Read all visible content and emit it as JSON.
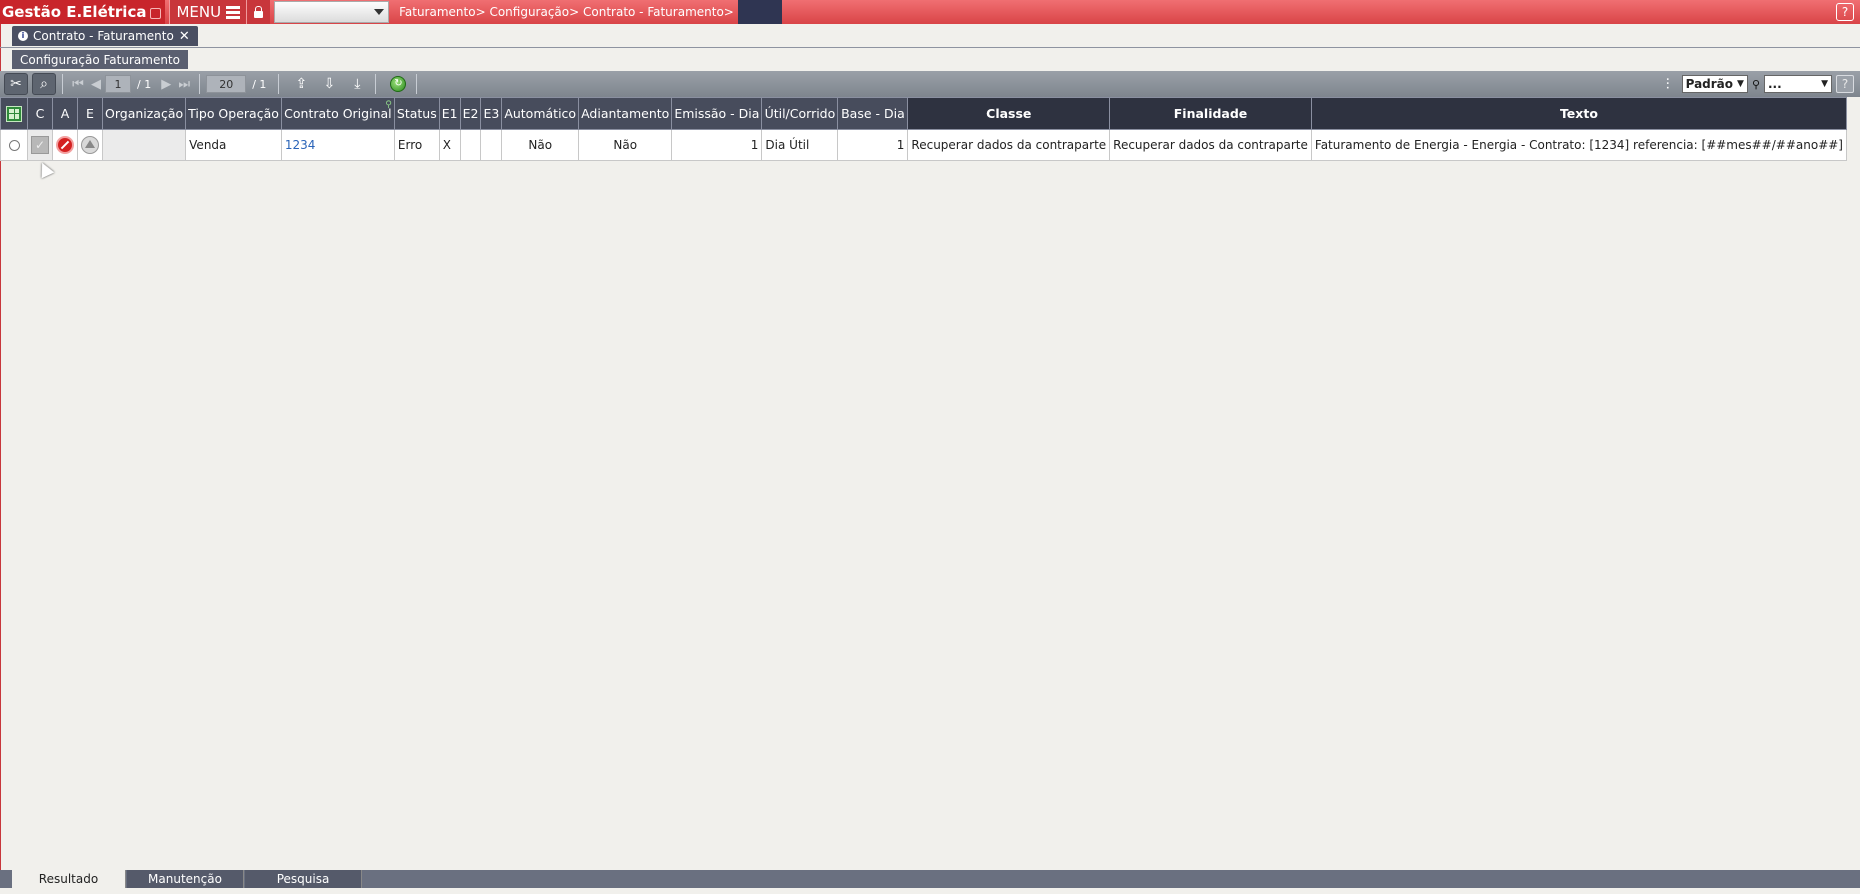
{
  "app": {
    "title": "Gestão E.Elétrica",
    "menu_label": "MENU",
    "breadcrumb": "Faturamento> Configuração> Contrato - Faturamento>",
    "help_label": "?"
  },
  "window_tab": {
    "label": "Contrato - Faturamento",
    "info_label": "i",
    "close_label": "✕"
  },
  "sub_tab": {
    "label": "Configuração Faturamento"
  },
  "toolbar": {
    "page_current": "1",
    "page_total": "/ 1",
    "rows_per_page": "20",
    "rows_total": "/ 1",
    "layout_select": "Padrão",
    "search_select": "...",
    "help_label": "?"
  },
  "grid": {
    "columns": [
      "",
      "C",
      "A",
      "E",
      "Organização",
      "Tipo Operação",
      "Contrato Original",
      "Status",
      "E1",
      "E2",
      "E3",
      "Automático",
      "Adiantamento",
      "Emissão - Dia",
      "Útil/Corrido",
      "Base - Dia",
      "Classe",
      "Finalidade",
      "Texto"
    ],
    "rows": [
      {
        "organizacao": "",
        "tipo_operacao": "Venda",
        "contrato_original": "1234",
        "status": "Erro",
        "e1": "X",
        "e2": "",
        "e3": "",
        "automatico": "Não",
        "adiantamento": "Não",
        "emissao_dia": "1",
        "util_corrido": "Dia Útil",
        "base_dia": "1",
        "classe": "Recuperar dados da contraparte",
        "finalidade": "Recuperar dados da contraparte",
        "texto": "Faturamento de Energia - Energia - Contrato: [1234] referencia: [##mes##/##ano##]"
      }
    ]
  },
  "bottom_tabs": [
    "Resultado",
    "Manutenção",
    "Pesquisa"
  ],
  "colors": {
    "topbar": "#d94447",
    "brand": "#c8252b",
    "header": "#474c5c",
    "header_dark": "#2e3240",
    "link": "#2a64b8"
  }
}
